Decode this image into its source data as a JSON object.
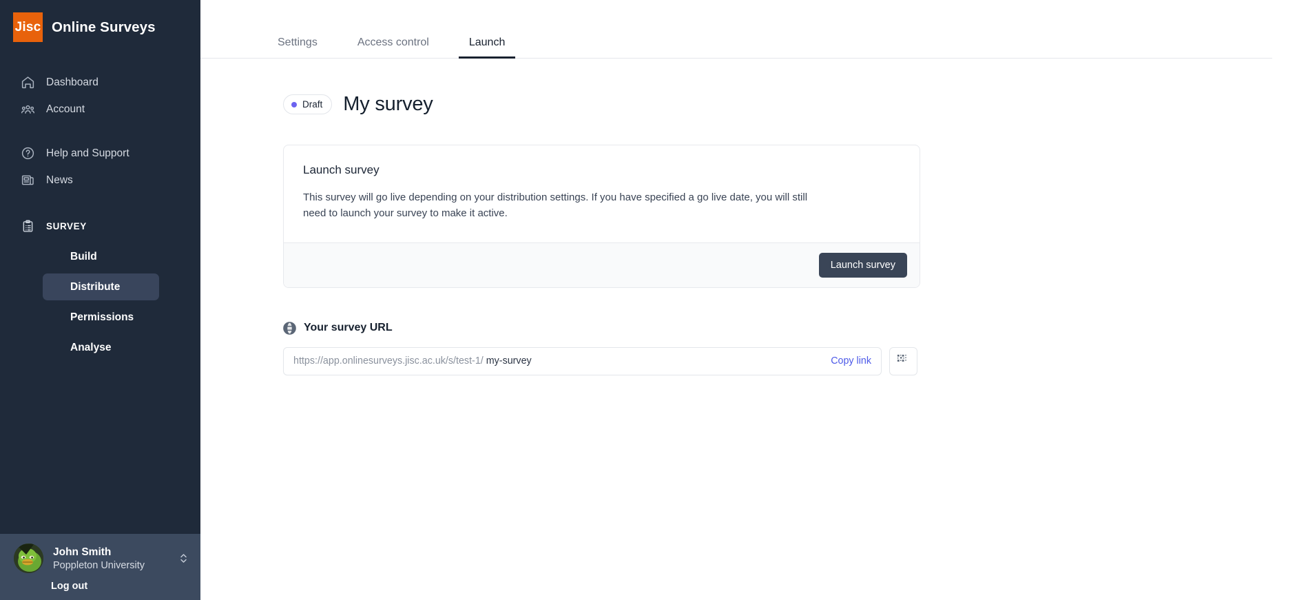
{
  "brand": {
    "logo_text": "Jisc",
    "title": "Online Surveys",
    "logo_color": "#e8620b"
  },
  "sidebar": {
    "nav": [
      {
        "label": "Dashboard",
        "icon": "home-icon"
      },
      {
        "label": "Account",
        "icon": "users-icon"
      },
      {
        "label": "Help and Support",
        "icon": "question-circle-icon"
      },
      {
        "label": "News",
        "icon": "newspaper-icon"
      }
    ],
    "section": {
      "label": "SURVEY",
      "icon": "clipboard-list-icon"
    },
    "sub_items": [
      {
        "label": "Build",
        "active": false
      },
      {
        "label": "Distribute",
        "active": true
      },
      {
        "label": "Permissions",
        "active": false
      },
      {
        "label": "Analyse",
        "active": false
      }
    ],
    "profile": {
      "name": "John Smith",
      "organisation": "Poppleton University",
      "logout_label": "Log out",
      "avatar_icon": "duck-avatar"
    }
  },
  "main": {
    "tabs": [
      {
        "label": "Settings",
        "active": false
      },
      {
        "label": "Access control",
        "active": false
      },
      {
        "label": "Launch",
        "active": true
      }
    ],
    "status_badge": {
      "label": "Draft",
      "dot_color": "#6c63f0"
    },
    "page_title": "My survey",
    "launch_card": {
      "title": "Launch survey",
      "description": "This survey will go live depending on your distribution settings. If you have specified a go live date, you will still need to launch your survey to make it active.",
      "button_label": "Launch survey"
    },
    "survey_url": {
      "heading": "Your survey URL",
      "heading_icon": "globe-icon",
      "prefix": "https://app.onlinesurveys.jisc.ac.uk/s/test-1/",
      "slug": "my-survey",
      "copy_label": "Copy link",
      "qr_icon": "qr-code-icon"
    }
  }
}
